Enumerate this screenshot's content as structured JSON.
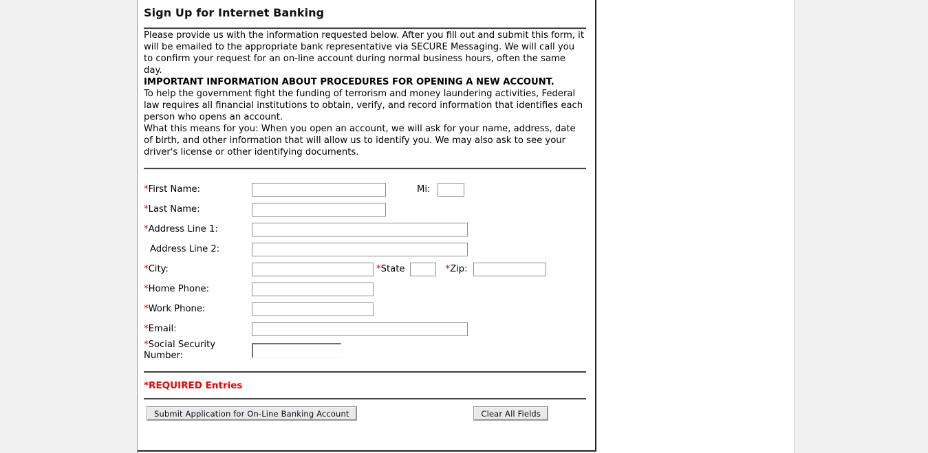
{
  "page": {
    "title": "Sign Up for Internet Banking"
  },
  "intro": {
    "paragraph": "Please provide us with the information requested below.   After you fill out and submit this form, it will be emailed to the appropriate bank representative via SECURE Messaging.  We will call you to confirm your request for an on-line account during normal business hours, often the same day."
  },
  "notice": {
    "heading": "IMPORTANT INFORMATION ABOUT PROCEDURES FOR OPENING A NEW ACCOUNT.",
    "body_line_1": "To help the government fight the funding of terrorism and money laundering activities, Federal law requires all financial institutions to obtain, verify, and record information that identifies each person who opens an account.",
    "body_line_2": "What this means for you: When you open an account, we will ask for your name, address, date of birth, and other information that will allow us to identify you. We may also ask to see your driver's license or other identifying documents."
  },
  "form": {
    "required_marker": "*",
    "fields": {
      "first_name": {
        "label": "First Name:",
        "value": "",
        "required": true
      },
      "mi": {
        "label": "Mi:",
        "value": "",
        "required": false
      },
      "last_name": {
        "label": "Last Name:",
        "value": "",
        "required": true
      },
      "address1": {
        "label": "Address Line 1:",
        "value": "",
        "required": true
      },
      "address2": {
        "label": "Address Line 2:",
        "value": "",
        "required": false
      },
      "city": {
        "label": "City:",
        "value": "",
        "required": true
      },
      "state": {
        "label": "State",
        "value": "",
        "required": true
      },
      "zip": {
        "label": "Zip:",
        "value": "",
        "required": true
      },
      "home_phone": {
        "label": "Home Phone:",
        "value": "",
        "required": true
      },
      "work_phone": {
        "label": "Work Phone:",
        "value": "",
        "required": true
      },
      "email": {
        "label": "Email:",
        "value": "",
        "required": true
      },
      "ssn": {
        "label": "Social Security Number:",
        "label_line_1": "Social Security",
        "label_line_2": "Number:",
        "value": "",
        "required": true
      }
    },
    "required_note": "*REQUIRED Entries",
    "buttons": {
      "submit": "Submit Application for On-Line Banking Account",
      "clear": "Clear All Fields"
    }
  },
  "colors": {
    "required_red": "#d40000",
    "note_red": "#ee0000",
    "rule": "#444444",
    "input_border": "#8c8c8c",
    "page_background": "#f1f1f1",
    "content_background": "#ffffff"
  }
}
